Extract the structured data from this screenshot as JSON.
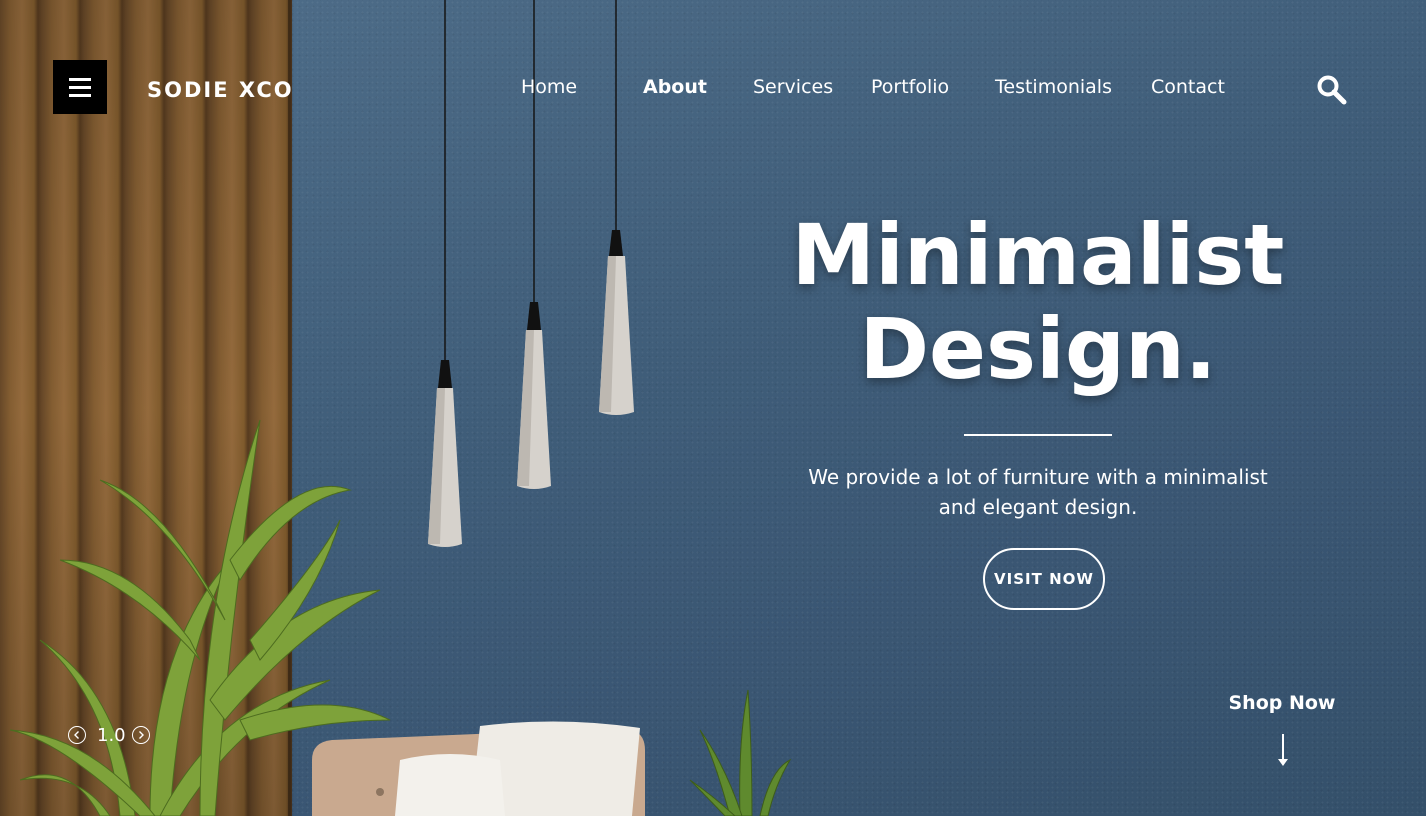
{
  "header": {
    "brand": "SODIE XCO",
    "menu_icon": "hamburger-menu-icon",
    "search_icon": "search-icon"
  },
  "nav": {
    "active": "About",
    "items": [
      {
        "label": "Home"
      },
      {
        "label": "About"
      },
      {
        "label": "Services"
      },
      {
        "label": "Portfolio"
      },
      {
        "label": "Testimonials"
      },
      {
        "label": "Contact"
      }
    ]
  },
  "hero": {
    "title_line1": "Minimalist",
    "title_line2": "Design.",
    "description_line1": "We provide a lot of furniture with a minimalist",
    "description_line2": "and elegant design.",
    "cta_label": "VISIT NOW"
  },
  "slider": {
    "counter": "1.0",
    "prev_icon": "chevron-left-icon",
    "next_icon": "chevron-right-icon"
  },
  "shop": {
    "label": "Shop Now",
    "arrow_icon": "arrow-down-icon"
  },
  "colors": {
    "wall_blue": "#4a6985",
    "wood": "#8a6234",
    "menu_bg": "#000000",
    "text": "#ffffff"
  }
}
